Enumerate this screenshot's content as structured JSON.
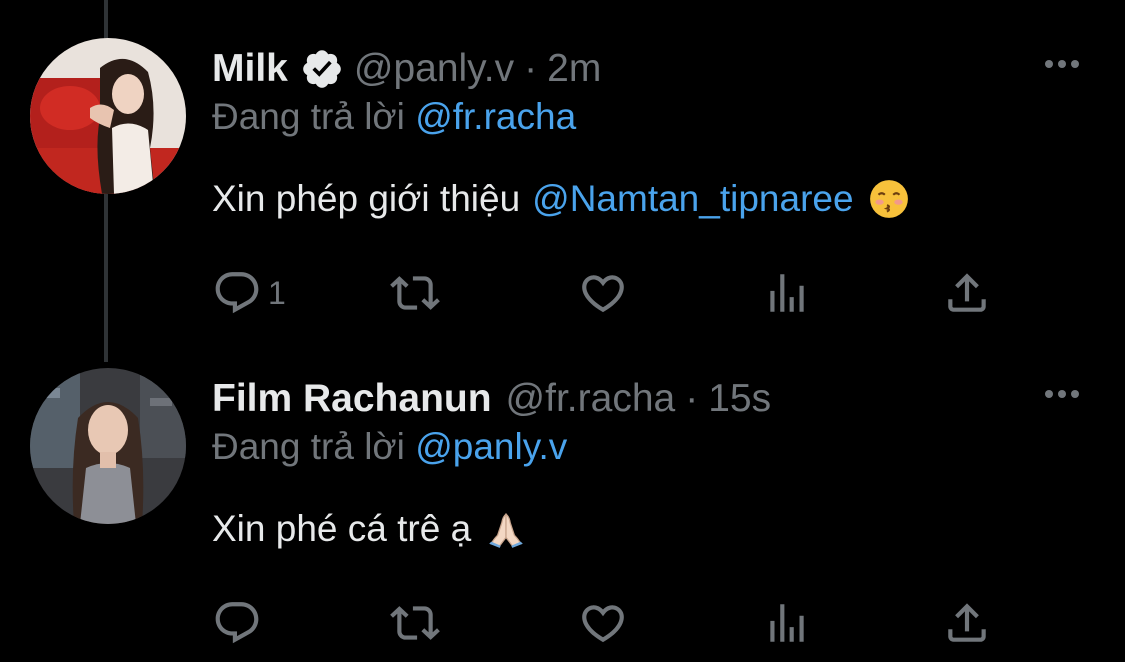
{
  "tweets": [
    {
      "display_name": "Milk",
      "verified": true,
      "handle": "@panly.v",
      "separator": "·",
      "time": "2m",
      "reply_prefix": "Đang trả lời",
      "reply_to": "@fr.racha",
      "text": "Xin phép giới thiệu",
      "text_mention": "@Namtan_tipnaree",
      "emoji": "kissing-face-emoji",
      "reply_count": "1",
      "avatar": "avatar-milk"
    },
    {
      "display_name": "Film Rachanun",
      "verified": false,
      "handle": "@fr.racha",
      "separator": "·",
      "time": "15s",
      "reply_prefix": "Đang trả lời",
      "reply_to": "@panly.v",
      "text": "Xin phé cá trê ạ",
      "emoji": "folded-hands-emoji",
      "reply_count": "",
      "avatar": "avatar-film"
    }
  ],
  "colors": {
    "background": "#000000",
    "text_primary": "#e7e9ea",
    "text_secondary": "#71767b",
    "link": "#4aa3ec",
    "thread_line": "#2f3336"
  },
  "icons": [
    "reply-icon",
    "retweet-icon",
    "like-icon",
    "views-icon",
    "share-icon",
    "more-icon",
    "verified-badge-icon"
  ]
}
